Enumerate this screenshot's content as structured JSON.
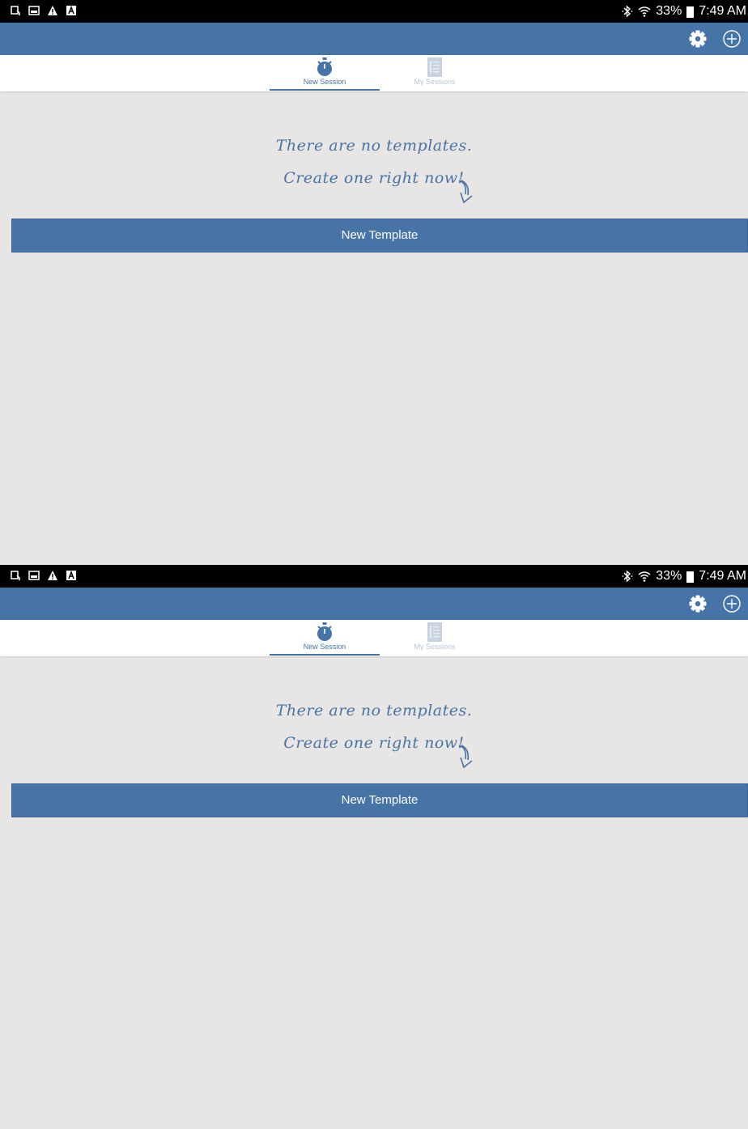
{
  "colors": {
    "accent": "#4674a6",
    "background": "#e8e6e4",
    "statusbar": "#000000",
    "inactive_tab": "#b8c6d6"
  },
  "statusbar": {
    "left_icons": [
      "download-icon",
      "image-icon",
      "warning-icon",
      "font-icon"
    ],
    "right_icons": [
      "bluetooth-icon",
      "wifi-icon",
      "battery-icon"
    ],
    "battery": "33%",
    "time": "7:49 AM"
  },
  "appbar": {
    "actions": [
      "gear-icon",
      "add-circle-icon"
    ]
  },
  "tabs": [
    {
      "label": "New Session",
      "icon": "stopwatch-icon",
      "selected": true
    },
    {
      "label": "My Sessions",
      "icon": "list-document-icon",
      "selected": false
    }
  ],
  "empty_state": {
    "line1": "There are no templates.",
    "line2": "Create one right now!",
    "arrow_icon": "curved-arrow-down-icon"
  },
  "new_template_button": {
    "label": "New Template"
  }
}
